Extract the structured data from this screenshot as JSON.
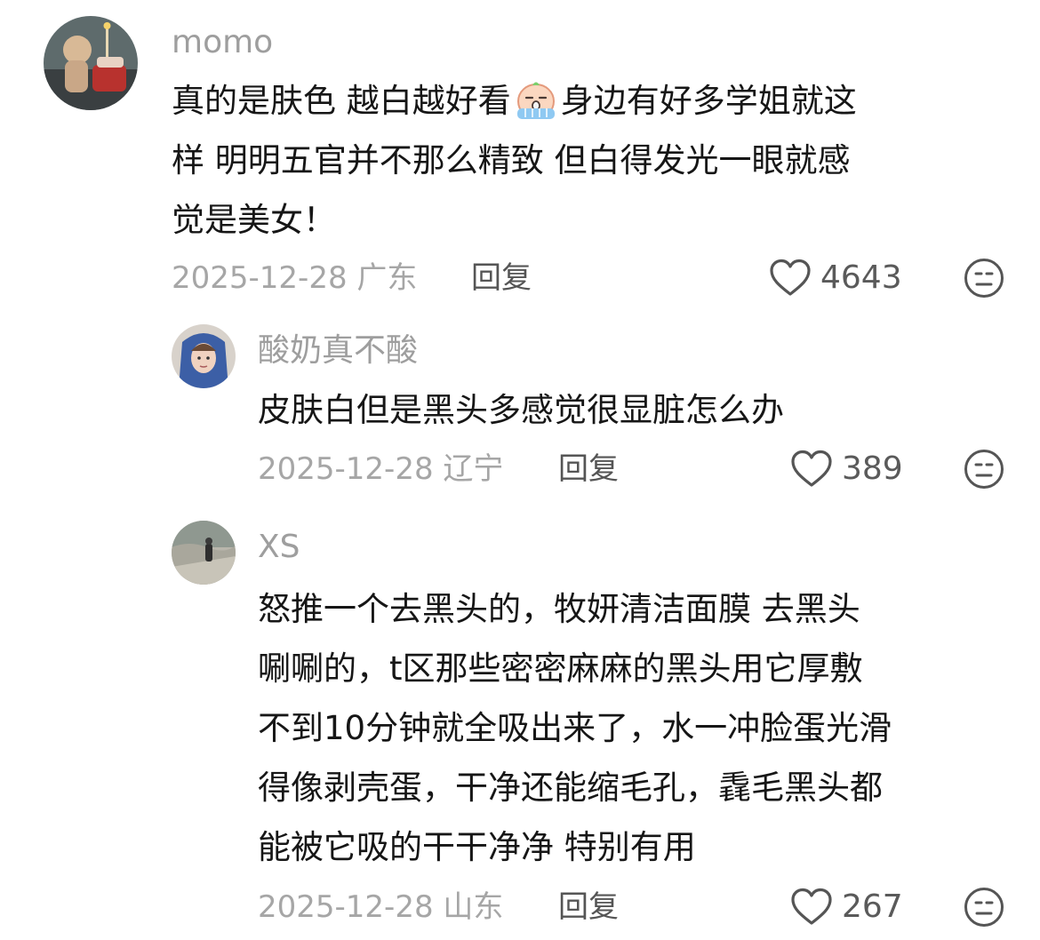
{
  "comments": [
    {
      "username": "momo",
      "lines": [
        "真的是肤色 越白越好看",
        "身边有好多学姐就这",
        "样 明明五官并不那么精致 但白得发光一眼就感",
        "觉是美女！"
      ],
      "emoji": "crying-face-emoji",
      "date_location": "2025-12-28 广东",
      "reply_label": "回复",
      "likes": "4643",
      "avatar_icon": "user-avatar-icon"
    },
    {
      "username": "酸奶真不酸",
      "lines": [
        "皮肤白但是黑头多感觉很显脏怎么办"
      ],
      "date_location": "2025-12-28 辽宁",
      "reply_label": "回复",
      "likes": "389",
      "avatar_icon": "user-avatar-icon"
    },
    {
      "username": "XS",
      "lines": [
        "怒推一个去黑头的，牧妍清洁面膜 去黑头",
        "唰唰的，t区那些密密麻麻的黑头用它厚敷",
        "不到10分钟就全吸出来了，水一冲脸蛋光滑",
        "得像剥壳蛋，干净还能缩毛孔，毳毛黑头都",
        "能被它吸的干干净净 特别有用"
      ],
      "date_location": "2025-12-28 山东",
      "reply_label": "回复",
      "likes": "267",
      "avatar_icon": "user-avatar-icon"
    }
  ],
  "icons": {
    "like": "heart-icon",
    "dislike": "neutral-face-icon"
  },
  "colors": {
    "text": "#161616",
    "muted": "#a6a6a6",
    "username": "#9e9e9e",
    "reply": "#555555"
  }
}
